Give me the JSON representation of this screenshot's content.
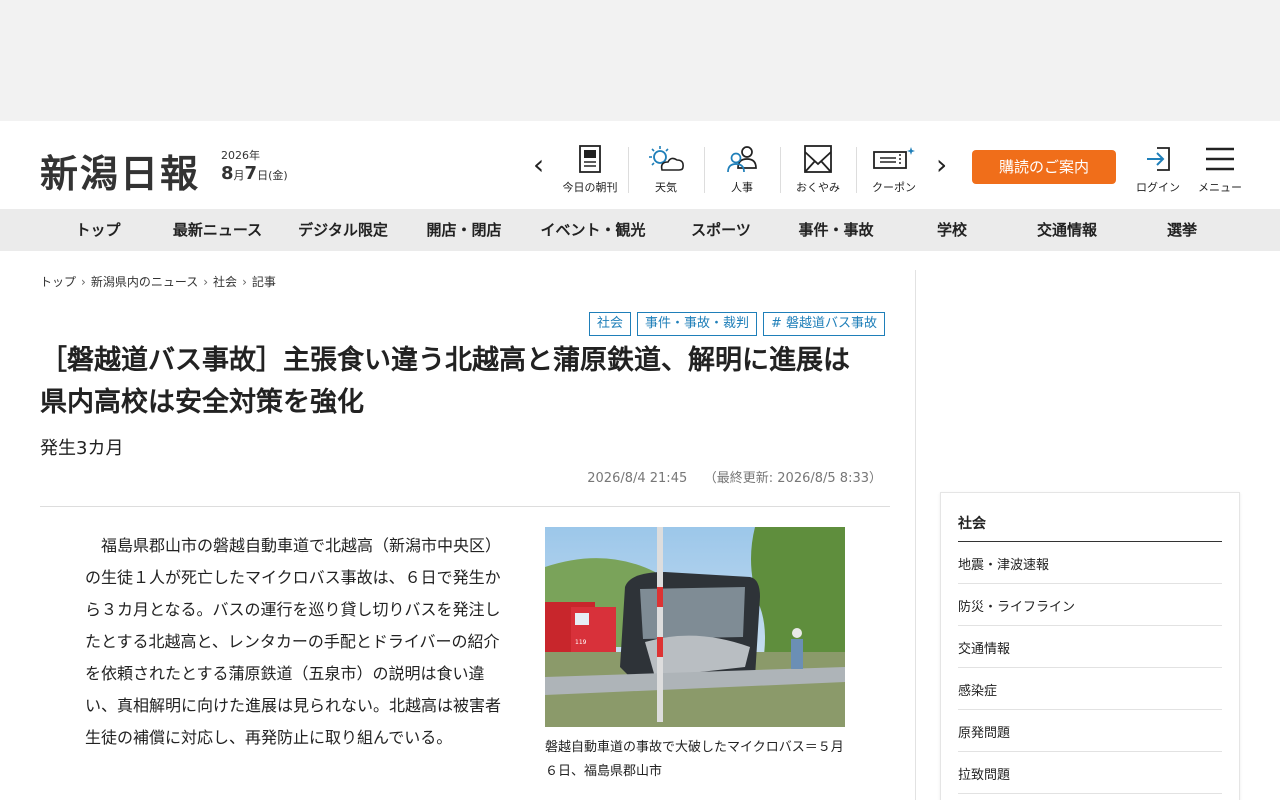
{
  "header": {
    "logo": "新潟日報",
    "date_year": "2026年",
    "date_month": "8",
    "date_month_unit": "月",
    "date_day": "7",
    "date_day_unit": "日",
    "date_weekday": "(金)",
    "icons": [
      {
        "name": "today-paper",
        "label": "今日の朝刊",
        "icon": "newspaper-icon"
      },
      {
        "name": "weather",
        "label": "天気",
        "icon": "weather-icon"
      },
      {
        "name": "personnel",
        "label": "人事",
        "icon": "people-icon"
      },
      {
        "name": "obituary",
        "label": "おくやみ",
        "icon": "envelope-icon"
      },
      {
        "name": "coupon",
        "label": "クーポン",
        "icon": "coupon-icon"
      }
    ],
    "subscribe_label": "購読のご案内",
    "login_label": "ログイン",
    "menu_label": "メニュー"
  },
  "global_nav": [
    "トップ",
    "最新ニュース",
    "デジタル限定",
    "開店・閉店",
    "イベント・観光",
    "スポーツ",
    "事件・事故",
    "学校",
    "交通情報",
    "選挙"
  ],
  "breadcrumb": [
    "トップ",
    "新潟県内のニュース",
    "社会",
    "記事"
  ],
  "tags": [
    "社会",
    "事件・事故・裁判",
    "# 磐越道バス事故"
  ],
  "article": {
    "headline_line1": "［磐越道バス事故］主張食い違う北越高と蒲原鉄道、解明に進展は",
    "headline_line2": "県内高校は安全対策を強化",
    "subhead": "発生3カ月",
    "published": "2026/8/4 21:45",
    "updated": "（最終更新: 2026/8/5 8:33）",
    "body": "福島県郡山市の磐越自動車道で北越高（新潟市中央区）の生徒１人が死亡したマイクロバス事故は、６日で発生から３カ月となる。バスの運行を巡り貸し切りバスを発注したとする北越高と、レンタカーの手配とドライバーの紹介を依頼されたとする蒲原鉄道（五泉市）の説明は食い違い、真相解明に向けた進展は見られない。北越高は被害者生徒の補償に対応し、再発防止に取り組んでいる。",
    "photo_caption": "磐越自動車道の事故で大破したマイクロバス＝５月６日、福島県郡山市",
    "fire_truck_number": "119"
  },
  "sidebar": {
    "title": "社会",
    "items": [
      "地震・津波速報",
      "防災・ライフライン",
      "交通情報",
      "感染症",
      "原発問題",
      "拉致問題"
    ]
  },
  "colors": {
    "accent_orange": "#f06e1a",
    "tag_blue": "#1f7fb9",
    "nav_bg": "#ebebeb"
  }
}
